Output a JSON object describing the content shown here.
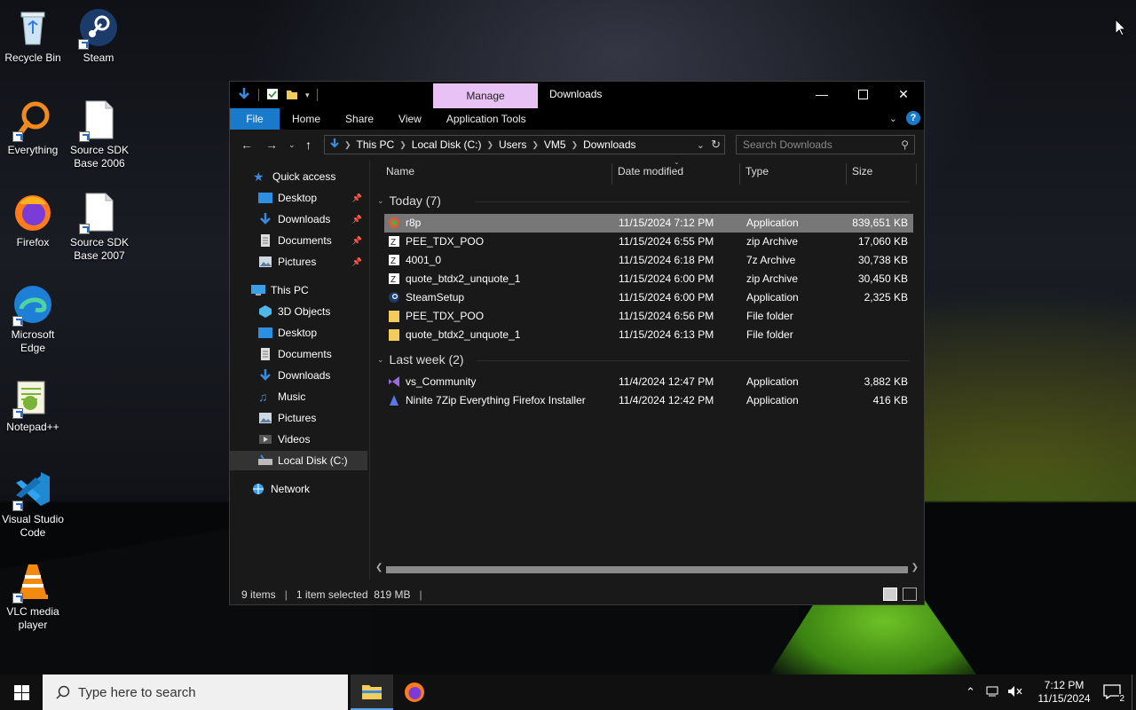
{
  "desktop": {
    "icons": [
      {
        "label": "Recycle Bin"
      },
      {
        "label": "Steam"
      },
      {
        "label": "Everything"
      },
      {
        "label": "Source SDK Base 2006"
      },
      {
        "label": "Firefox"
      },
      {
        "label": "Source SDK Base 2007"
      },
      {
        "label": "Microsoft Edge"
      },
      {
        "label": "Notepad++"
      },
      {
        "label": "Visual Studio Code"
      },
      {
        "label": "VLC media player"
      }
    ]
  },
  "window": {
    "title": "Downloads",
    "contextual_tab": "Manage",
    "ribbon_tabs": [
      "File",
      "Home",
      "Share",
      "View",
      "Application Tools"
    ],
    "address": {
      "crumbs": [
        "This PC",
        "Local Disk (C:)",
        "Users",
        "VM5",
        "Downloads"
      ]
    },
    "search_placeholder": "Search Downloads",
    "nav": {
      "quick_access": "Quick access",
      "quick_items": [
        "Desktop",
        "Downloads",
        "Documents",
        "Pictures"
      ],
      "this_pc": "This PC",
      "pc_items": [
        "3D Objects",
        "Desktop",
        "Documents",
        "Downloads",
        "Music",
        "Pictures",
        "Videos",
        "Local Disk (C:)"
      ],
      "network": "Network"
    },
    "columns": {
      "name": "Name",
      "date": "Date modified",
      "type": "Type",
      "size": "Size"
    },
    "groups": [
      {
        "label": "Today (7)",
        "rows": [
          {
            "name": "r8p",
            "date": "11/15/2024 7:12 PM",
            "type": "Application",
            "size": "839,651 KB"
          },
          {
            "name": "PEE_TDX_POO",
            "date": "11/15/2024 6:55 PM",
            "type": "zip Archive",
            "size": "17,060 KB"
          },
          {
            "name": "4001_0",
            "date": "11/15/2024 6:18 PM",
            "type": "7z Archive",
            "size": "30,738 KB"
          },
          {
            "name": "quote_btdx2_unquote_1",
            "date": "11/15/2024 6:00 PM",
            "type": "zip Archive",
            "size": "30,450 KB"
          },
          {
            "name": "SteamSetup",
            "date": "11/15/2024 6:00 PM",
            "type": "Application",
            "size": "2,325 KB"
          },
          {
            "name": "PEE_TDX_POO",
            "date": "11/15/2024 6:56 PM",
            "type": "File folder",
            "size": ""
          },
          {
            "name": "quote_btdx2_unquote_1",
            "date": "11/15/2024 6:13 PM",
            "type": "File folder",
            "size": ""
          }
        ]
      },
      {
        "label": "Last week (2)",
        "rows": [
          {
            "name": "vs_Community",
            "date": "11/4/2024 12:47 PM",
            "type": "Application",
            "size": "3,882 KB"
          },
          {
            "name": "Ninite 7Zip Everything Firefox Installer",
            "date": "11/4/2024 12:42 PM",
            "type": "Application",
            "size": "416 KB"
          }
        ]
      }
    ],
    "status": {
      "items": "9 items",
      "selected": "1 item selected  819 MB"
    }
  },
  "taskbar": {
    "search_placeholder": "Type here to search",
    "time": "7:12 PM",
    "date": "11/15/2024",
    "notification_count": "2"
  }
}
